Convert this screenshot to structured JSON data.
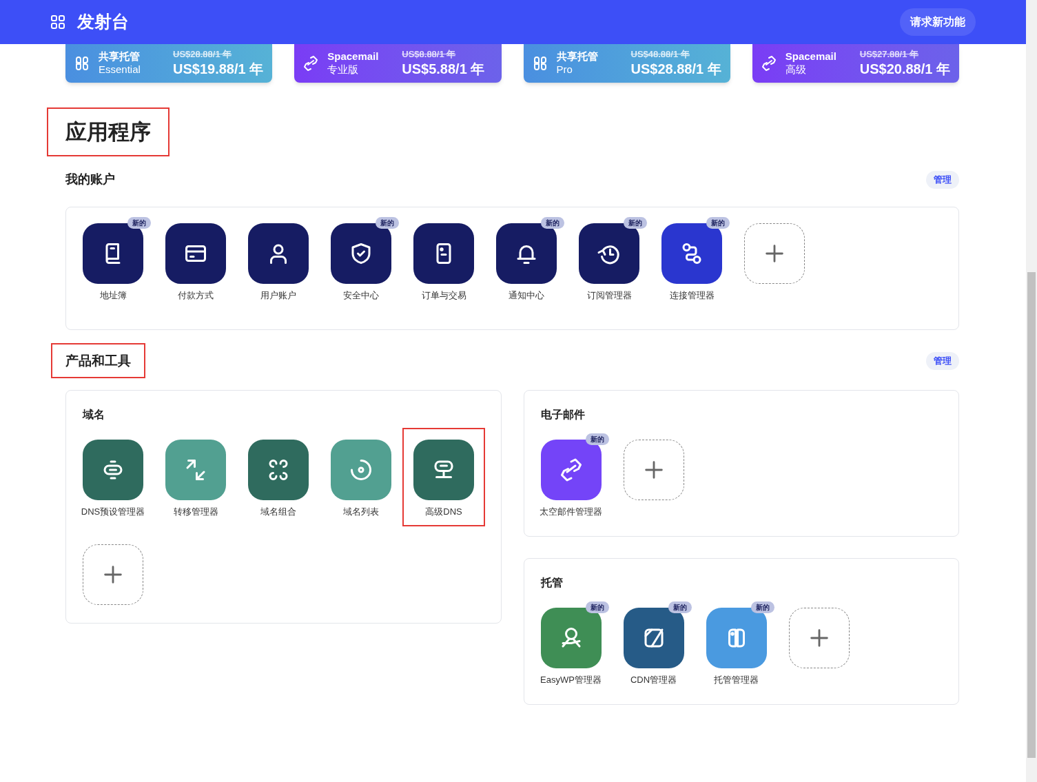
{
  "header": {
    "title": "发射台",
    "request_button": "请求新功能"
  },
  "promos": [
    {
      "kind": "hosting",
      "name": "共享托管",
      "plan": "Essential",
      "old_price": "US$28.88/1 年",
      "price": "US$19.88/1 年"
    },
    {
      "kind": "email",
      "name": "Spacemail",
      "plan": "专业版",
      "old_price": "US$8.88/1 年",
      "price": "US$5.88/1 年"
    },
    {
      "kind": "hosting",
      "name": "共享托管",
      "plan": "Pro",
      "old_price": "US$48.88/1 年",
      "price": "US$28.88/1 年"
    },
    {
      "kind": "email",
      "name": "Spacemail",
      "plan": "高级",
      "old_price": "US$27.88/1 年",
      "price": "US$20.88/1 年"
    }
  ],
  "applications": {
    "title": "应用程序",
    "highlighted": true,
    "account": {
      "title": "我的账户",
      "manage": "管理",
      "apps": [
        {
          "label": "地址簿",
          "color": "#161c63",
          "badge": "新的",
          "highlighted": false
        },
        {
          "label": "付款方式",
          "color": "#161c63",
          "highlighted": false
        },
        {
          "label": "用户账户",
          "color": "#161c63",
          "highlighted": false
        },
        {
          "label": "安全中心",
          "color": "#161c63",
          "badge": "新的",
          "highlighted": false
        },
        {
          "label": "订单与交易",
          "color": "#161c63",
          "highlighted": false
        },
        {
          "label": "通知中心",
          "color": "#161c63",
          "badge": "新的",
          "highlighted": false
        },
        {
          "label": "订阅管理器",
          "color": "#161c63",
          "badge": "新的",
          "highlighted": false
        },
        {
          "label": "连接管理器",
          "color": "#2a36cf",
          "badge": "新的",
          "highlighted": false
        }
      ]
    }
  },
  "products": {
    "title": "产品和工具",
    "highlighted": true,
    "manage": "管理",
    "groups": [
      {
        "title": "域名",
        "apps": [
          {
            "label": "DNS预设管理器",
            "color": "#2f6b5e",
            "highlighted": false
          },
          {
            "label": "转移管理器",
            "color": "#52a091",
            "highlighted": false
          },
          {
            "label": "域名组合",
            "color": "#2f6b5e",
            "highlighted": false
          },
          {
            "label": "域名列表",
            "color": "#52a091",
            "highlighted": false
          },
          {
            "label": "高级DNS",
            "color": "#2f6b5e",
            "highlighted": true
          }
        ]
      },
      {
        "title": "电子邮件",
        "apps": [
          {
            "label": "太空邮件管理器",
            "color": "#7444f8",
            "badge": "新的",
            "highlighted": false
          }
        ]
      },
      {
        "title": "托管",
        "apps": [
          {
            "label": "EasyWP管理器",
            "color": "#3f8e55",
            "badge": "新的",
            "highlighted": false
          },
          {
            "label": "CDN管理器",
            "color": "#265b87",
            "badge": "新的",
            "highlighted": false
          },
          {
            "label": "托管管理器",
            "color": "#4a9ae0",
            "badge": "新的",
            "highlighted": false
          }
        ]
      }
    ]
  }
}
